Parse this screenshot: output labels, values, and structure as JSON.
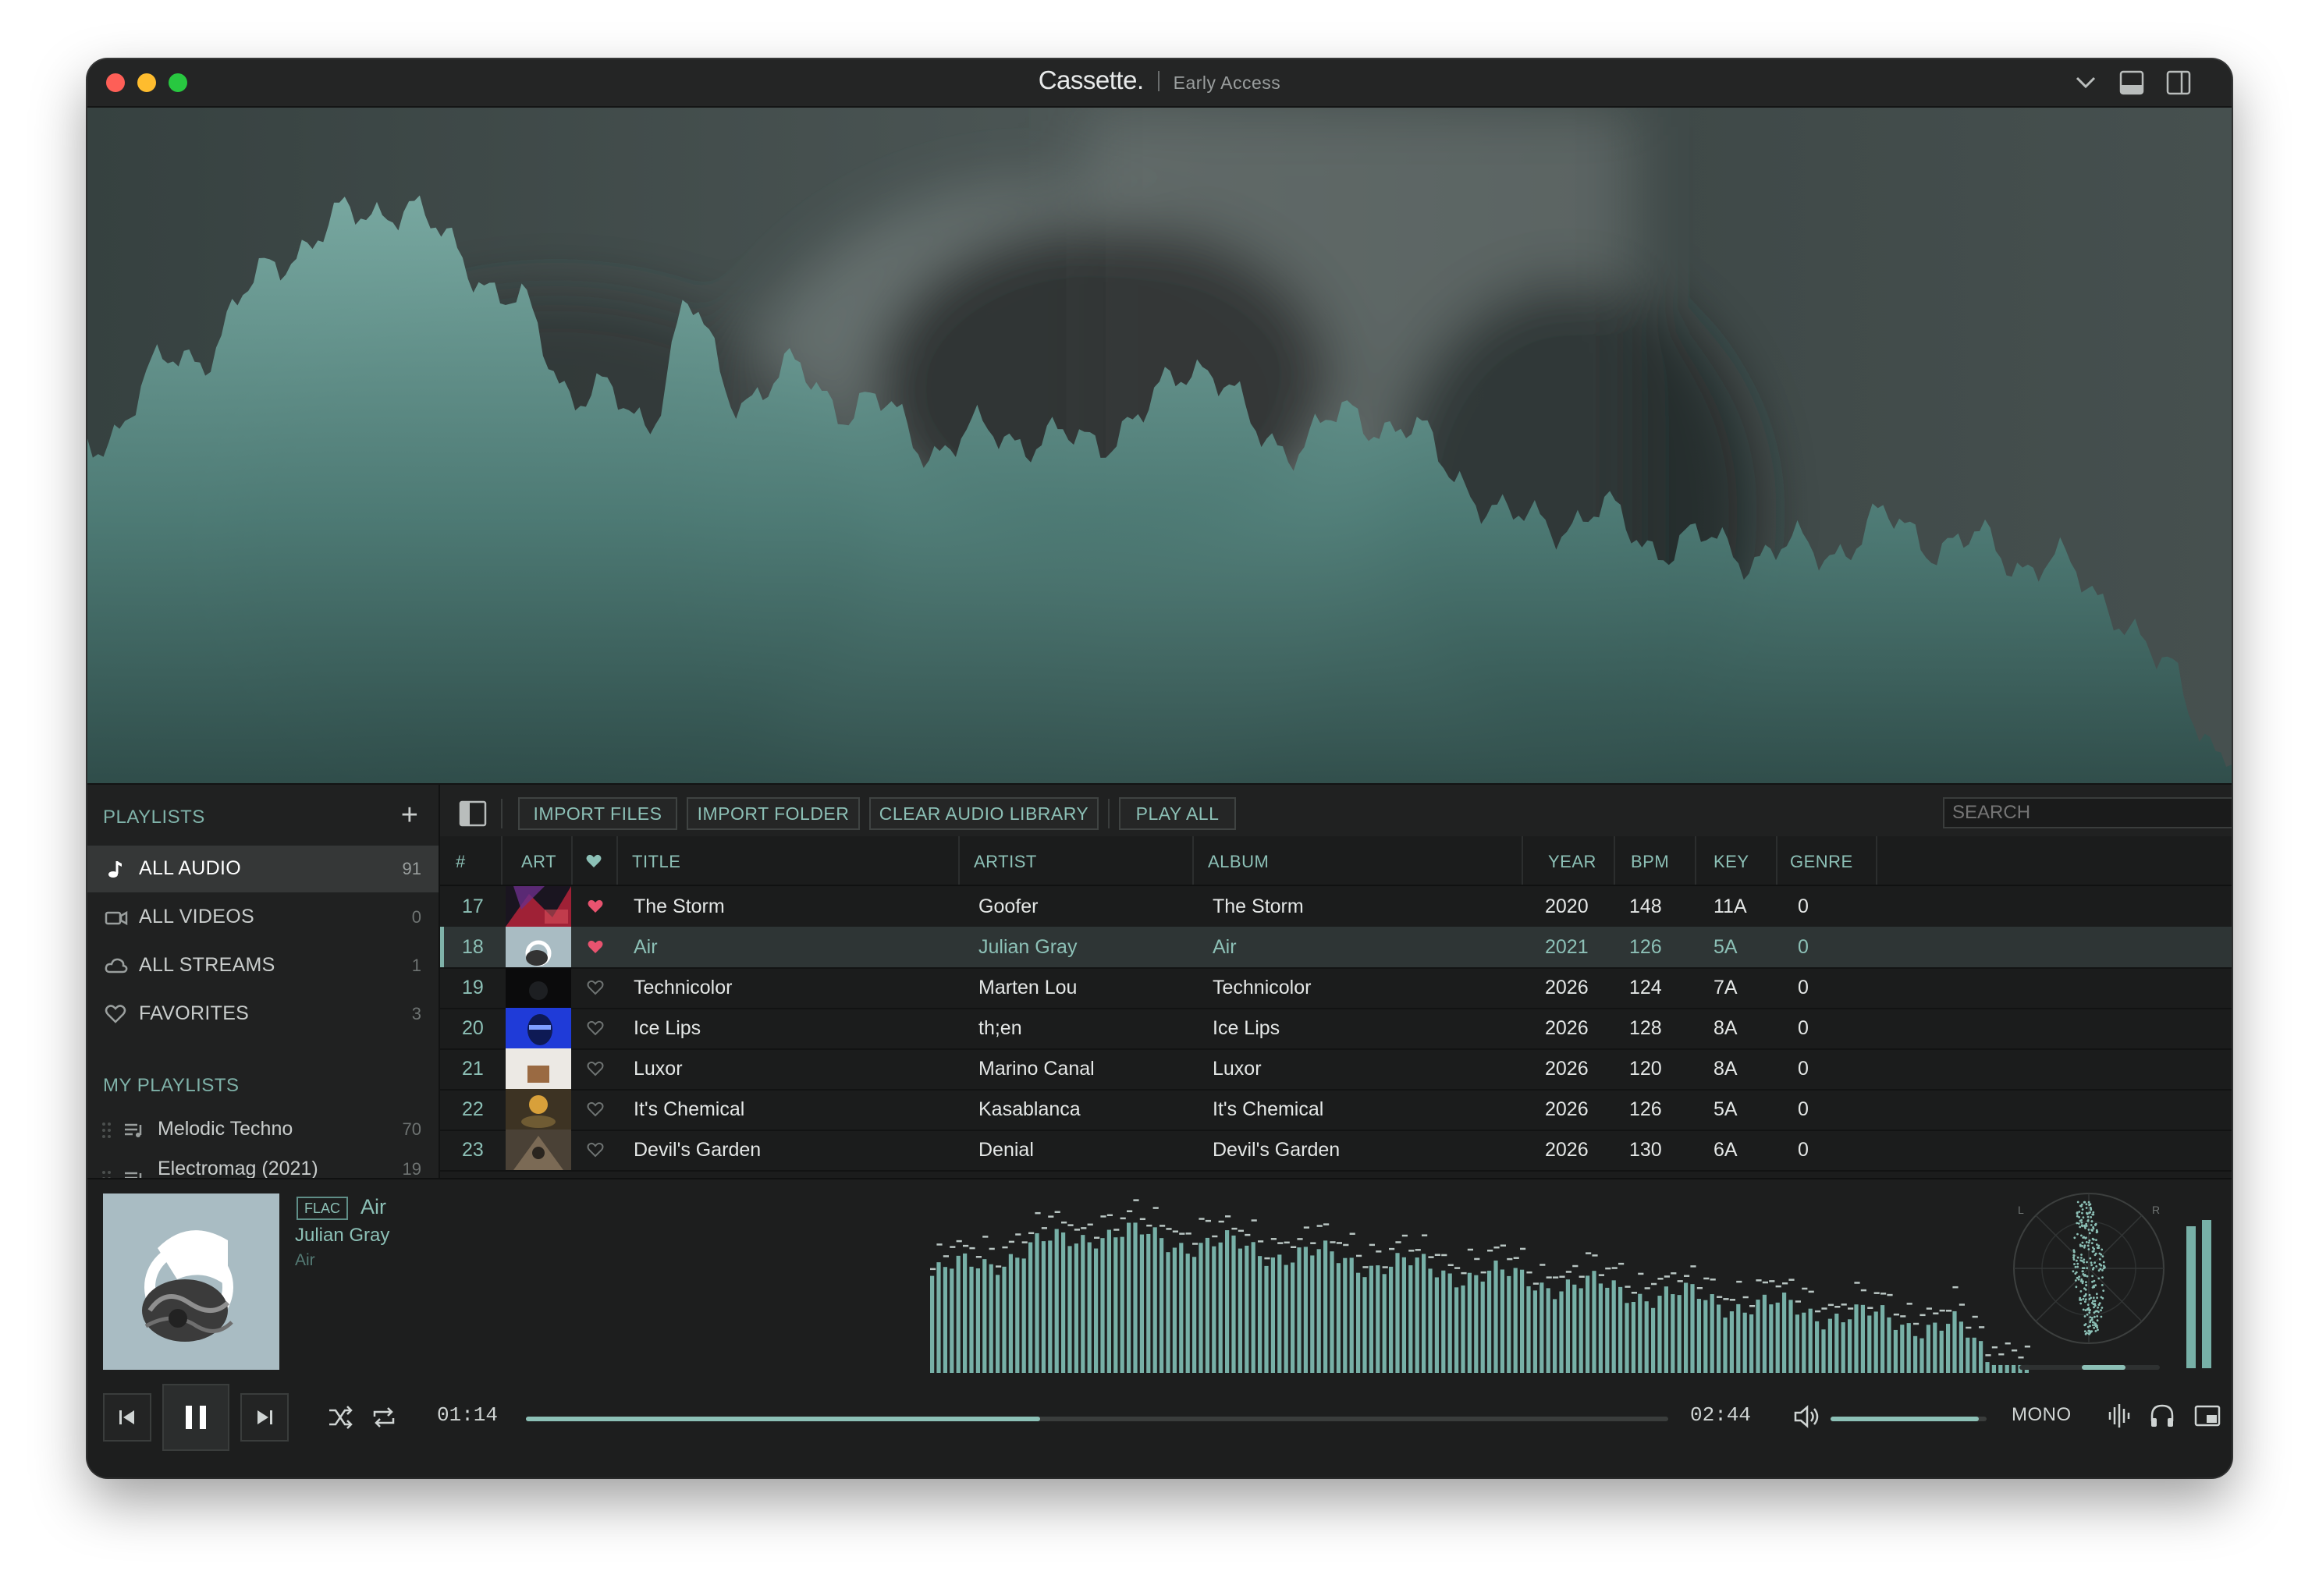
{
  "window": {
    "app_name": "Cassette.",
    "badge": "Early Access"
  },
  "sidebar": {
    "playlists_header": "PLAYLISTS",
    "items": [
      {
        "label": "ALL AUDIO",
        "count": "91",
        "icon": "music-note-icon"
      },
      {
        "label": "ALL VIDEOS",
        "count": "0",
        "icon": "video-icon"
      },
      {
        "label": "ALL STREAMS",
        "count": "1",
        "icon": "cloud-icon"
      },
      {
        "label": "FAVORITES",
        "count": "3",
        "icon": "heart-icon"
      }
    ],
    "my_playlists_header": "MY PLAYLISTS",
    "playlists": [
      {
        "label": "Melodic Techno",
        "count": "70"
      },
      {
        "label": "Electromag (2021)",
        "count": "19"
      }
    ]
  },
  "toolbar": {
    "import_files": "IMPORT FILES",
    "import_folder": "IMPORT FOLDER",
    "clear_library": "CLEAR AUDIO LIBRARY",
    "play_all": "PLAY ALL",
    "search_placeholder": "SEARCH"
  },
  "table": {
    "columns": [
      "#",
      "ART",
      "TITLE",
      "ARTIST",
      "ALBUM",
      "YEAR",
      "BPM",
      "KEY",
      "GENRE"
    ],
    "rows": [
      {
        "num": "17",
        "title": "The Storm",
        "artist": "Goofer",
        "album": "The Storm",
        "year": "2020",
        "bpm": "148",
        "key": "11A",
        "genre": "0",
        "favorite": true
      },
      {
        "num": "18",
        "title": "Air",
        "artist": "Julian Gray",
        "album": "Air",
        "year": "2021",
        "bpm": "126",
        "key": "5A",
        "genre": "0",
        "favorite": true
      },
      {
        "num": "19",
        "title": "Technicolor",
        "artist": "Marten Lou",
        "album": "Technicolor",
        "year": "2026",
        "bpm": "124",
        "key": "7A",
        "genre": "0",
        "favorite": false
      },
      {
        "num": "20",
        "title": "Ice Lips",
        "artist": "th;en",
        "album": "Ice Lips",
        "year": "2026",
        "bpm": "128",
        "key": "8A",
        "genre": "0",
        "favorite": false
      },
      {
        "num": "21",
        "title": "Luxor",
        "artist": "Marino Canal",
        "album": "Luxor",
        "year": "2026",
        "bpm": "120",
        "key": "8A",
        "genre": "0",
        "favorite": false
      },
      {
        "num": "22",
        "title": "It's Chemical",
        "artist": "Kasablanca",
        "album": "It's Chemical",
        "year": "2026",
        "bpm": "126",
        "key": "5A",
        "genre": "0",
        "favorite": false
      },
      {
        "num": "23",
        "title": "Devil's Garden",
        "artist": "Denial",
        "album": "Devil's Garden",
        "year": "2026",
        "bpm": "130",
        "key": "6A",
        "genre": "0",
        "favorite": false
      }
    ]
  },
  "now_playing": {
    "format": "FLAC",
    "title": "Air",
    "artist": "Julian Gray",
    "album": "Air",
    "elapsed": "01:14",
    "duration": "02:44",
    "progress": 0.45,
    "volume": 0.95,
    "mono_label": "MONO",
    "scope_left": "L",
    "scope_right": "R"
  },
  "colors": {
    "accent": "#8cc0b6",
    "heart": "#e8536f",
    "background": "#1c1d1d"
  }
}
